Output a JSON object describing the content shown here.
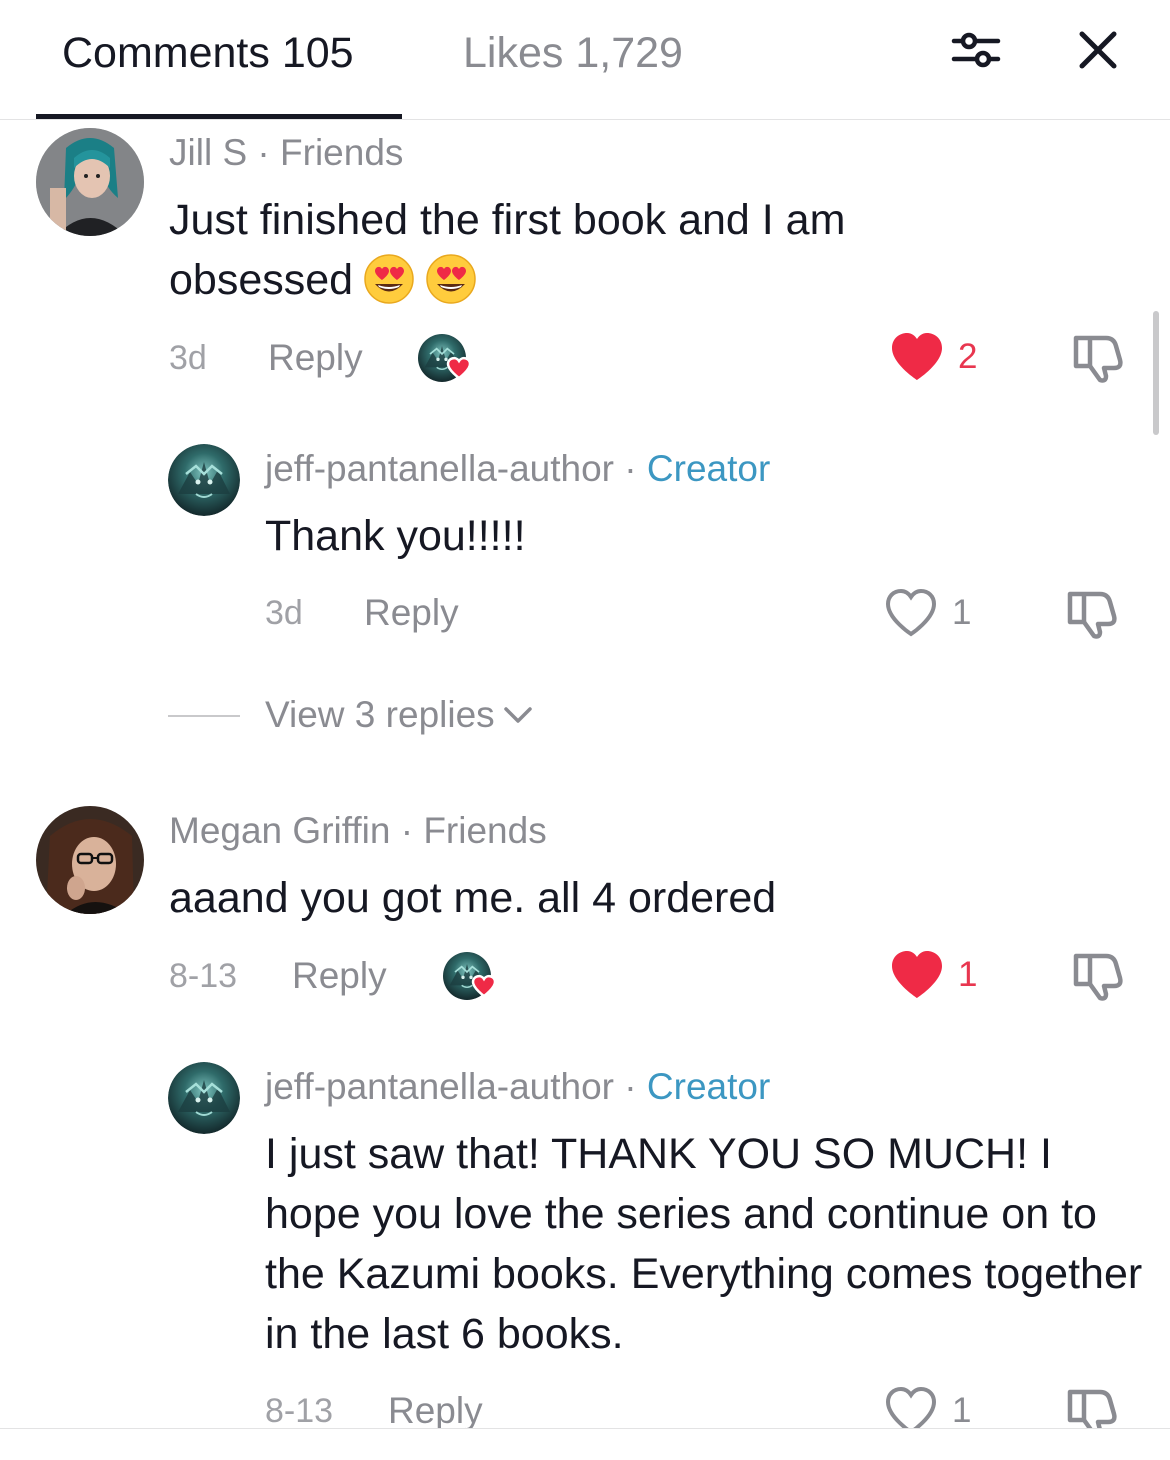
{
  "header": {
    "comments_tab": "Comments 105",
    "likes_tab": "Likes 1,729"
  },
  "comments": [
    {
      "author": "Jill S",
      "relation": "Friends",
      "separator": " · ",
      "text": "Just finished the first book and I am obsessed",
      "time": "3d",
      "reply_label": "Reply",
      "likes": "2",
      "liked": true,
      "reply": {
        "author": "jeff-pantanella-author",
        "role": "Creator",
        "text": "Thank you!!!!!",
        "time": "3d",
        "reply_label": "Reply",
        "likes": "1"
      },
      "view_replies": "View 3 replies"
    },
    {
      "author": "Megan Griffin",
      "relation": "Friends",
      "separator": " · ",
      "text": "aaand you got me. all 4 ordered",
      "time": "8-13",
      "reply_label": "Reply",
      "likes": "1",
      "liked": true,
      "reply": {
        "author": "jeff-pantanella-author",
        "role": "Creator",
        "text": "I just saw that! THANK YOU SO MUCH! I hope you love the series and continue on to the Kazumi books. Everything comes together in the last 6 books.",
        "time": "8-13",
        "reply_label": "Reply",
        "likes": "1"
      }
    }
  ],
  "colors": {
    "accent_red": "#e8364f",
    "creator_blue": "#3c97c2",
    "muted_gray": "#8a8b91"
  },
  "icons": [
    "filter-icon",
    "close-icon",
    "heart-filled-icon",
    "heart-outline-icon",
    "dislike-icon",
    "heart-eyes-emoji",
    "chevron-down-icon"
  ]
}
